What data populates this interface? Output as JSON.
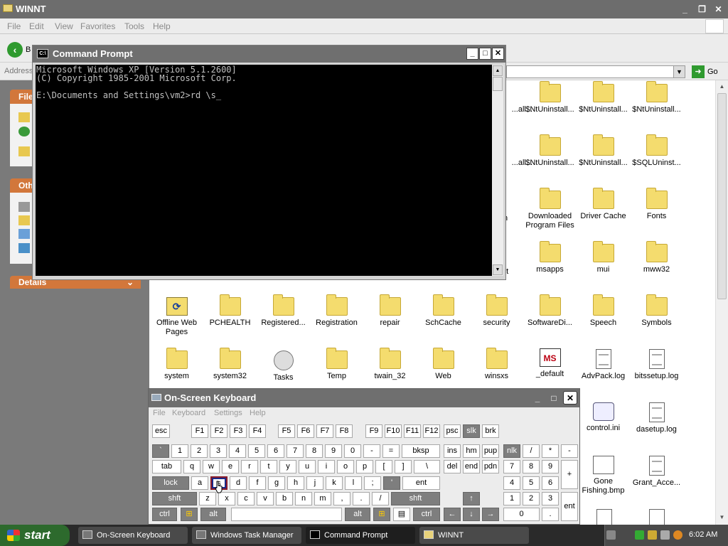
{
  "explorer": {
    "title": "WINNT",
    "menu": [
      "File",
      "Edit",
      "View",
      "Favorites",
      "Tools",
      "Help"
    ],
    "back_label": "B",
    "address_label": "Address",
    "go_label": "Go",
    "left_pane": {
      "file_tasks_label": "File",
      "other_places_label": "Oth",
      "details_label": "Details"
    },
    "row0": [
      {
        "label": "...all...",
        "icon": "folder"
      },
      {
        "label": "$NtUninstall...",
        "icon": "folder"
      },
      {
        "label": "$NtUninstall...",
        "icon": "folder"
      },
      {
        "label": "$NtUninstall...",
        "icon": "folder"
      }
    ],
    "row1": [
      {
        "label": "...all...",
        "icon": "folder"
      },
      {
        "label": "$NtUninstall...",
        "icon": "folder"
      },
      {
        "label": "$NtUninstall...",
        "icon": "folder"
      },
      {
        "label": "$SQLUninst...",
        "icon": "folder"
      }
    ],
    "row2_partial": "n",
    "row2": [
      {
        "label": "Downloaded Program Files",
        "icon": "folder"
      },
      {
        "label": "Driver Cache",
        "icon": "folder"
      },
      {
        "label": "Fonts",
        "icon": "folder"
      }
    ],
    "row3_partial": "nt",
    "row3": [
      {
        "label": "msapps",
        "icon": "folder"
      },
      {
        "label": "mui",
        "icon": "folder"
      },
      {
        "label": "mww32",
        "icon": "folder"
      }
    ],
    "row4": [
      {
        "label": "Offline Web Pages",
        "icon": "offline"
      },
      {
        "label": "PCHEALTH",
        "icon": "folder"
      },
      {
        "label": "Registered...",
        "icon": "folder"
      },
      {
        "label": "Registration",
        "icon": "folder"
      },
      {
        "label": "repair",
        "icon": "folder"
      },
      {
        "label": "SchCache",
        "icon": "folder"
      },
      {
        "label": "security",
        "icon": "folder"
      },
      {
        "label": "SoftwareDi...",
        "icon": "folder"
      },
      {
        "label": "Speech",
        "icon": "folder"
      },
      {
        "label": "Symbols",
        "icon": "folder"
      }
    ],
    "row5": [
      {
        "label": "system",
        "icon": "folder"
      },
      {
        "label": "system32",
        "icon": "folder"
      },
      {
        "label": "Tasks",
        "icon": "tasks"
      },
      {
        "label": "Temp",
        "icon": "folder"
      },
      {
        "label": "twain_32",
        "icon": "folder"
      },
      {
        "label": "Web",
        "icon": "folder"
      },
      {
        "label": "winsxs",
        "icon": "folder"
      },
      {
        "label": "_default",
        "icon": "ms"
      },
      {
        "label": "AdvPack.log",
        "icon": "doc"
      },
      {
        "label": "bitssetup.log",
        "icon": "doc"
      }
    ],
    "row6": [
      {
        "label": "control.ini",
        "icon": "cog"
      },
      {
        "label": "dasetup.log",
        "icon": "doc"
      }
    ],
    "row7": [
      {
        "label": "Gone Fishing.bmp",
        "icon": "paint"
      },
      {
        "label": "Grant_Acce...",
        "icon": "doc"
      }
    ]
  },
  "cmd": {
    "title": "Command Prompt",
    "lines": [
      "Microsoft Windows XP [Version 5.1.2600]",
      "(C) Copyright 1985-2001 Microsoft Corp.",
      "",
      "E:\\Documents and Settings\\vm2>rd \\s_"
    ]
  },
  "osk": {
    "title": "On-Screen Keyboard",
    "menu": [
      "File",
      "Keyboard",
      "Settings",
      "Help"
    ],
    "keys": {
      "r1": [
        "esc",
        "F1",
        "F2",
        "F3",
        "F4",
        "F5",
        "F6",
        "F7",
        "F8",
        "F9",
        "F10",
        "F11",
        "F12",
        "psc",
        "slk",
        "brk"
      ],
      "r2": [
        "`",
        "1",
        "2",
        "3",
        "4",
        "5",
        "6",
        "7",
        "8",
        "9",
        "0",
        "-",
        "=",
        "bksp",
        "ins",
        "hm",
        "pup",
        "nlk",
        "/",
        "*",
        "-"
      ],
      "r3": [
        "tab",
        "q",
        "w",
        "e",
        "r",
        "t",
        "y",
        "u",
        "i",
        "o",
        "p",
        "[",
        "]",
        "\\",
        "del",
        "end",
        "pdn",
        "7",
        "8",
        "9",
        "+"
      ],
      "r4": [
        "lock",
        "a",
        "s",
        "d",
        "f",
        "g",
        "h",
        "j",
        "k",
        "l",
        ";",
        "'",
        "ent",
        "4",
        "5",
        "6"
      ],
      "r5": [
        "shft",
        "z",
        "x",
        "c",
        "v",
        "b",
        "n",
        "m",
        ",",
        ".",
        "/",
        "shft",
        "↑",
        "1",
        "2",
        "3",
        "ent"
      ],
      "r6": [
        "ctrl",
        "⊞",
        "alt",
        "",
        "alt",
        "⊞",
        "▤",
        "ctrl",
        "←",
        "↓",
        "→",
        "0",
        "."
      ]
    }
  },
  "taskbar": {
    "start_label": "start",
    "tasks": [
      "On-Screen Keyboard",
      "Windows Task Manager",
      "Command Prompt",
      "WINNT"
    ],
    "clock": "6:02 AM"
  }
}
